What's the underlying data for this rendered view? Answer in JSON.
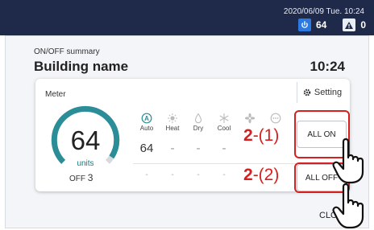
{
  "header": {
    "datetime": "2020/06/09 Tue. 10:24",
    "on_count": "64",
    "warning_count": "0"
  },
  "summary": {
    "subtitle": "ON/OFF summary",
    "building_name": "Building name",
    "time": "10:24"
  },
  "meter": {
    "label": "Meter",
    "value": "64",
    "units_label": "units",
    "off_label": "OFF",
    "off_count": "3",
    "gauge_fraction": 0.955,
    "gauge_color": "#2a8d97"
  },
  "setting": {
    "label": "Setting"
  },
  "modes": [
    {
      "icon": "auto-icon",
      "label": "Auto",
      "on_count": "64",
      "off": "-"
    },
    {
      "icon": "heat-icon",
      "label": "Heat",
      "on_count": "-",
      "off": "-"
    },
    {
      "icon": "dry-icon",
      "label": "Dry",
      "on_count": "-",
      "off": "-"
    },
    {
      "icon": "cool-icon",
      "label": "Cool",
      "on_count": "-",
      "off": "-"
    },
    {
      "icon": "fan-icon",
      "label": "",
      "on_count": "-",
      "off": "-"
    },
    {
      "icon": "more-icon",
      "label": "",
      "on_count": "-",
      "off": "-"
    }
  ],
  "buttons": {
    "all_on": "ALL ON",
    "all_off": "ALL OFF",
    "close": "CLO"
  },
  "annotations": {
    "one_num": "2",
    "one_suffix": "-(1)",
    "two_num": "2",
    "two_suffix": "-(2)"
  },
  "colors": {
    "header_bg": "#1f2a4a",
    "accent": "#2a8d97",
    "highlight": "#d62020"
  }
}
